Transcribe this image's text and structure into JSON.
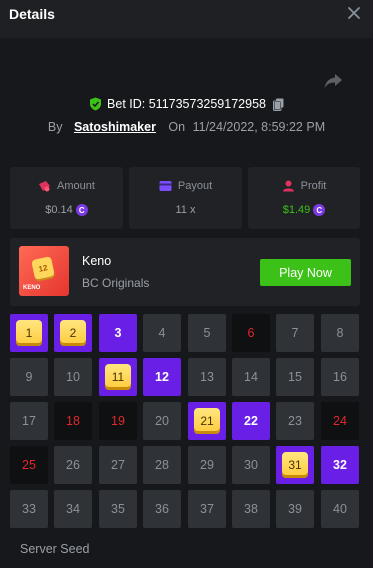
{
  "header": {
    "title": "Details",
    "close_icon": "close-icon"
  },
  "bet": {
    "id_text": "Bet ID: 5117357325917295​8",
    "by_label": "By",
    "username": "Satoshimaker",
    "on_label": "On",
    "date": "11/24/2022, 8:59:22 PM"
  },
  "stats": {
    "amount": {
      "label": "Amount",
      "value": "$0.14"
    },
    "payout": {
      "label": "Payout",
      "value": "11 x"
    },
    "profit": {
      "label": "Profit",
      "value": "$1.49"
    }
  },
  "game": {
    "name": "Keno",
    "provider": "BC Originals",
    "thumb_label": "KENO",
    "thumb_tile": "12",
    "play_label": "Play Now"
  },
  "grid": {
    "cells": [
      {
        "n": "1",
        "s": "hit"
      },
      {
        "n": "2",
        "s": "hit"
      },
      {
        "n": "3",
        "s": "pick"
      },
      {
        "n": "4",
        "s": "normal"
      },
      {
        "n": "5",
        "s": "normal"
      },
      {
        "n": "6",
        "s": "dark"
      },
      {
        "n": "7",
        "s": "normal"
      },
      {
        "n": "8",
        "s": "normal"
      },
      {
        "n": "9",
        "s": "normal"
      },
      {
        "n": "10",
        "s": "normal"
      },
      {
        "n": "11",
        "s": "hit"
      },
      {
        "n": "12",
        "s": "pick"
      },
      {
        "n": "13",
        "s": "normal"
      },
      {
        "n": "14",
        "s": "normal"
      },
      {
        "n": "15",
        "s": "normal"
      },
      {
        "n": "16",
        "s": "normal"
      },
      {
        "n": "17",
        "s": "normal"
      },
      {
        "n": "18",
        "s": "dark"
      },
      {
        "n": "19",
        "s": "dark"
      },
      {
        "n": "20",
        "s": "normal"
      },
      {
        "n": "21",
        "s": "hit"
      },
      {
        "n": "22",
        "s": "pick"
      },
      {
        "n": "23",
        "s": "normal"
      },
      {
        "n": "24",
        "s": "dark"
      },
      {
        "n": "25",
        "s": "dark"
      },
      {
        "n": "26",
        "s": "normal"
      },
      {
        "n": "27",
        "s": "normal"
      },
      {
        "n": "28",
        "s": "normal"
      },
      {
        "n": "29",
        "s": "normal"
      },
      {
        "n": "30",
        "s": "normal"
      },
      {
        "n": "31",
        "s": "hit"
      },
      {
        "n": "32",
        "s": "pick"
      },
      {
        "n": "33",
        "s": "normal"
      },
      {
        "n": "34",
        "s": "normal"
      },
      {
        "n": "35",
        "s": "normal"
      },
      {
        "n": "36",
        "s": "normal"
      },
      {
        "n": "37",
        "s": "normal"
      },
      {
        "n": "38",
        "s": "normal"
      },
      {
        "n": "39",
        "s": "normal"
      },
      {
        "n": "40",
        "s": "normal"
      }
    ]
  },
  "server_seed_label": "Server Seed",
  "colors": {
    "accent_purple": "#6a1fe6",
    "green": "#3bc117",
    "red": "#e0282d",
    "bg": "#17181b"
  }
}
